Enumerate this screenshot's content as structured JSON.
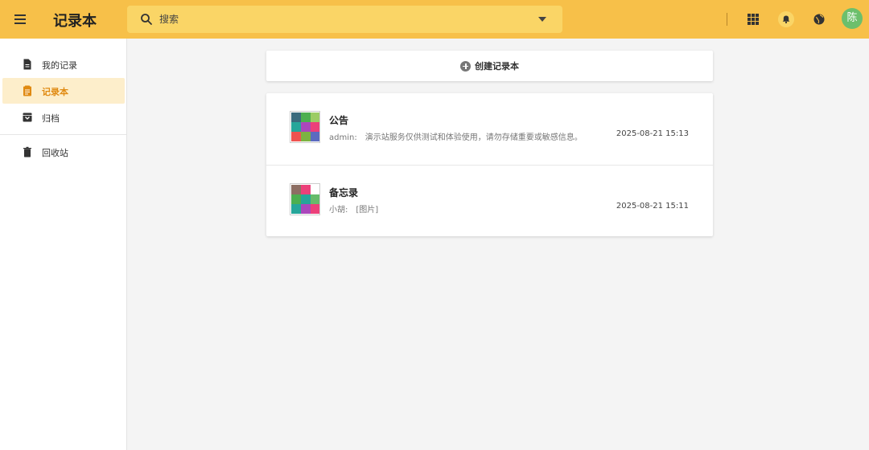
{
  "app": {
    "title": "记录本"
  },
  "search": {
    "placeholder": "搜索"
  },
  "user": {
    "avatar_text": "陈"
  },
  "sidebar": {
    "items": [
      {
        "label": "我的记录",
        "icon": "document-icon"
      },
      {
        "label": "记录本",
        "icon": "notebook-icon",
        "active": true
      },
      {
        "label": "归档",
        "icon": "archive-icon"
      },
      {
        "label": "回收站",
        "icon": "trash-icon"
      }
    ]
  },
  "main": {
    "create_label": "创建记录本",
    "notebooks": [
      {
        "title": "公告",
        "author": "admin:",
        "preview": "演示站服务仅供测试和体验使用，请勿存储重要或敏感信息。",
        "date": "2025-08-21 15:13"
      },
      {
        "title": "备忘录",
        "author": "小胡:",
        "preview": "[图片]",
        "date": "2025-08-21 15:11"
      }
    ]
  },
  "colors": {
    "topbar": "#f7c049",
    "search_bg": "#fad566",
    "active_bg": "#fdeecb",
    "active_text": "#e08a12",
    "avatar": "#6cbf6c"
  }
}
